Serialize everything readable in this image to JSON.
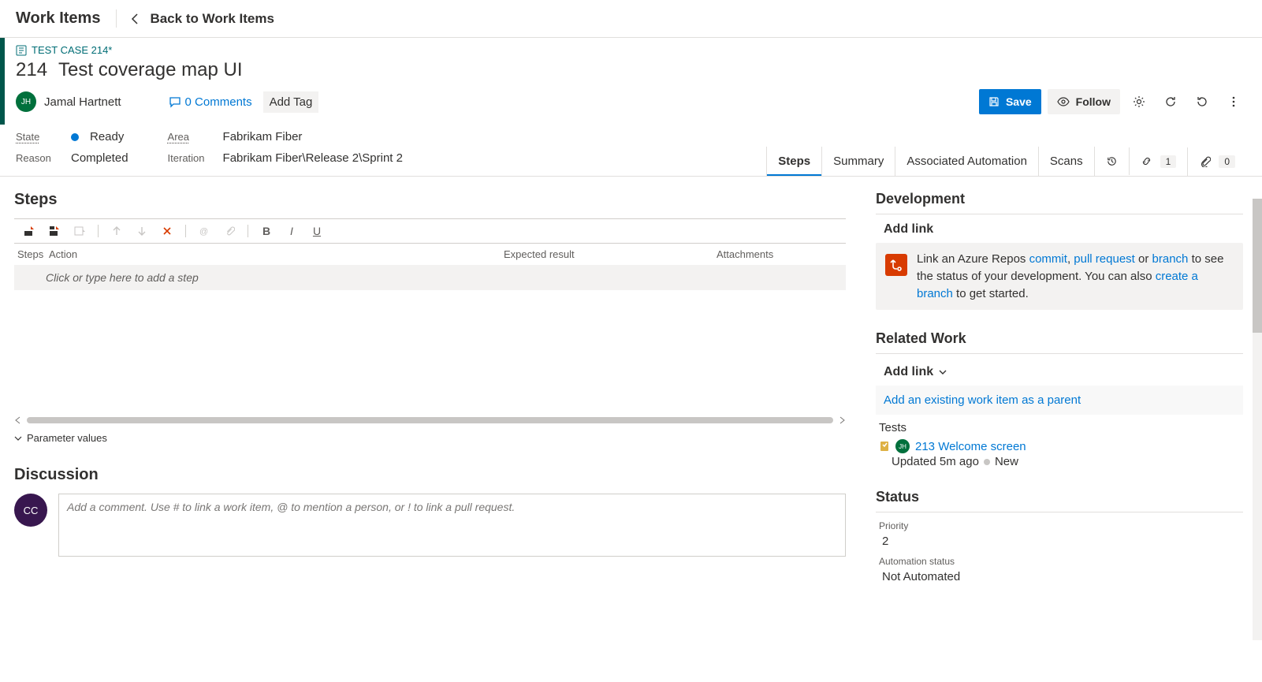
{
  "topbar": {
    "page_title": "Work Items",
    "back_label": "Back to Work Items"
  },
  "crumb": {
    "text": "TEST CASE 214*"
  },
  "item": {
    "id": "214",
    "title": "Test coverage map UI",
    "assignee_initials": "JH",
    "assignee_name": "Jamal Hartnett",
    "comments_label": "0 Comments",
    "add_tag_label": "Add Tag"
  },
  "toolbar": {
    "save_label": "Save",
    "follow_label": "Follow"
  },
  "meta": {
    "state_label": "State",
    "state_value": "Ready",
    "reason_label": "Reason",
    "reason_value": "Completed",
    "area_label": "Area",
    "area_value": "Fabrikam Fiber",
    "iteration_label": "Iteration",
    "iteration_value": "Fabrikam Fiber\\Release 2\\Sprint 2"
  },
  "tabs": {
    "steps": "Steps",
    "summary": "Summary",
    "automation": "Associated Automation",
    "scans": "Scans",
    "links_count": "1",
    "attach_count": "0"
  },
  "steps": {
    "heading": "Steps",
    "cols": {
      "a": "Steps",
      "b": "Action",
      "c": "Expected result",
      "d": "Attachments"
    },
    "placeholder": "Click or type here to add a step",
    "param_values": "Parameter values"
  },
  "discussion": {
    "heading": "Discussion",
    "avatar_initials": "CC",
    "placeholder": "Add a comment. Use # to link a work item, @ to mention a person, or ! to link a pull request."
  },
  "right": {
    "development_h": "Development",
    "add_link": "Add link",
    "dev_msg_prefix": "Link an Azure Repos ",
    "commit": "commit",
    "sep1": ", ",
    "pull_request": "pull request",
    "sep2": " or ",
    "branch": "branch",
    "dev_msg_mid": " to see the status of your development. You can also ",
    "create_branch": "create a branch",
    "dev_msg_suffix": " to get started.",
    "related_h": "Related Work",
    "add_existing": "Add an existing work item as a parent",
    "tests_label": "Tests",
    "test_id": "213",
    "test_title": "Welcome screen",
    "test_assignee_initials": "JH",
    "updated_prefix": "Updated ",
    "updated_time": "5m ago",
    "status_new": "New",
    "status_h": "Status",
    "priority_label": "Priority",
    "priority_value": "2",
    "automation_status_label": "Automation status",
    "automation_status_value": "Not Automated"
  }
}
